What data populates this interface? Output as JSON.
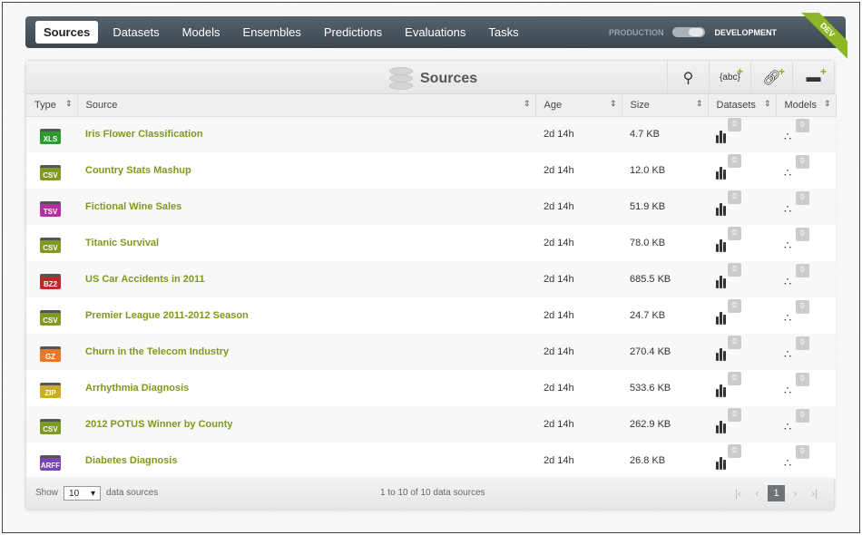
{
  "nav": {
    "tabs": [
      "Sources",
      "Datasets",
      "Models",
      "Ensembles",
      "Predictions",
      "Evaluations",
      "Tasks"
    ],
    "active": "Sources",
    "mode_production": "PRODUCTION",
    "mode_development": "DEVELOPMENT",
    "ribbon": "DEV"
  },
  "panel": {
    "title": "Sources",
    "tools": [
      "search-icon",
      "new-inline-source-icon",
      "new-remote-source-icon",
      "new-folder-icon"
    ]
  },
  "columns": [
    "Type",
    "Source",
    "Age",
    "Size",
    "Datasets",
    "Models"
  ],
  "rows": [
    {
      "type": "XLS",
      "color": "#2f9a2f",
      "name": "Iris Flower Classification",
      "age": "2d 14h",
      "size": "4.7 KB",
      "datasets": "0",
      "models": "0"
    },
    {
      "type": "CSV",
      "color": "#7d9a22",
      "name": "Country Stats Mashup",
      "age": "2d 14h",
      "size": "12.0 KB",
      "datasets": "0",
      "models": "0"
    },
    {
      "type": "TSV",
      "color": "#b42fa0",
      "name": "Fictional Wine Sales",
      "age": "2d 14h",
      "size": "51.9 KB",
      "datasets": "0",
      "models": "0"
    },
    {
      "type": "CSV",
      "color": "#7d9a22",
      "name": "Titanic Survival",
      "age": "2d 14h",
      "size": "78.0 KB",
      "datasets": "0",
      "models": "0"
    },
    {
      "type": "BZ2",
      "color": "#c0282b",
      "name": "US Car Accidents in 2011",
      "age": "2d 14h",
      "size": "685.5 KB",
      "datasets": "0",
      "models": "0"
    },
    {
      "type": "CSV",
      "color": "#7d9a22",
      "name": "Premier League 2011-2012 Season",
      "age": "2d 14h",
      "size": "24.7 KB",
      "datasets": "0",
      "models": "0"
    },
    {
      "type": "GZ",
      "color": "#e7772a",
      "name": "Churn in the Telecom Industry",
      "age": "2d 14h",
      "size": "270.4 KB",
      "datasets": "0",
      "models": "0"
    },
    {
      "type": "ZIP",
      "color": "#c9ae22",
      "name": "Arrhythmia Diagnosis",
      "age": "2d 14h",
      "size": "533.6 KB",
      "datasets": "0",
      "models": "0"
    },
    {
      "type": "CSV",
      "color": "#7d9a22",
      "name": "2012 POTUS Winner by County",
      "age": "2d 14h",
      "size": "262.9 KB",
      "datasets": "0",
      "models": "0"
    },
    {
      "type": "ARFF",
      "color": "#7a45b5",
      "name": "Diabetes Diagnosis",
      "age": "2d 14h",
      "size": "26.8 KB",
      "datasets": "0",
      "models": "0"
    }
  ],
  "footer": {
    "show_label": "Show",
    "page_size": "10",
    "suffix": "data sources",
    "info": "1 to 10 of 10 data sources",
    "current_page": "1"
  }
}
